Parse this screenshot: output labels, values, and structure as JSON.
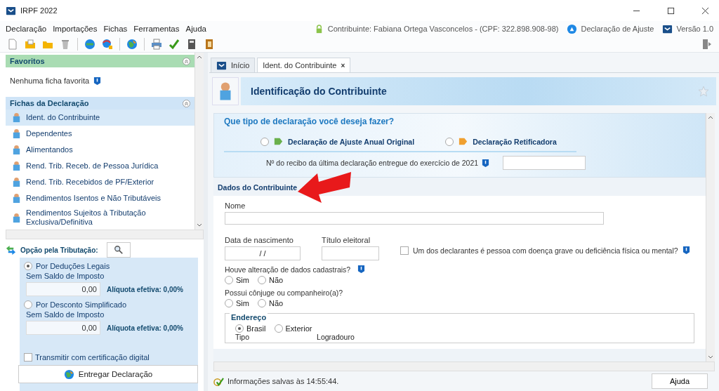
{
  "window": {
    "title": "IRPF 2022"
  },
  "menu": [
    {
      "label": "Declaração"
    },
    {
      "label": "Importações"
    },
    {
      "label": "Fichas"
    },
    {
      "label": "Ferramentas"
    },
    {
      "label": "Ajuda"
    }
  ],
  "header_info": {
    "contributor": "Contribuinte: Fabiana Ortega Vasconcelos - (CPF: 322.898.908-98)",
    "declaration": "Declaração de Ajuste",
    "version": "Versão 1.0"
  },
  "sidebar": {
    "favorites": {
      "title": "Favoritos",
      "empty_text": "Nenhuma ficha favorita"
    },
    "forms": {
      "title": "Fichas da Declaração",
      "items": [
        {
          "label": "Ident. do Contribuinte",
          "selected": true
        },
        {
          "label": "Dependentes",
          "selected": false
        },
        {
          "label": "Alimentandos",
          "selected": false
        },
        {
          "label": "Rend. Trib. Receb. de Pessoa Jurídica",
          "selected": false
        },
        {
          "label": "Rend. Trib. Recebidos de PF/Exterior",
          "selected": false
        },
        {
          "label": "Rendimentos Isentos e Não Tributáveis",
          "selected": false
        },
        {
          "label": "Rendimentos Sujeitos à Tributação Exclusiva/Definitiva",
          "selected": false
        }
      ]
    },
    "tax_option": {
      "title": "Opção pela Tributação:",
      "options": [
        {
          "label": "Por Deduções Legais",
          "selected": true,
          "balance_label": "Sem Saldo de Imposto",
          "value": "0,00",
          "rate": "Alíquota efetiva: 0,00%"
        },
        {
          "label": "Por Desconto Simplificado",
          "selected": false,
          "balance_label": "Sem Saldo de Imposto",
          "value": "0,00",
          "rate": "Alíquota efetiva: 0,00%"
        }
      ]
    },
    "certificate": {
      "label": "Transmitir com certificação digital",
      "checked": false
    },
    "submit_button": "Entregar Declaração"
  },
  "tabs": [
    {
      "label": "Início",
      "selected": false
    },
    {
      "label": "Ident. do Contribuinte",
      "selected": true,
      "close": "×"
    }
  ],
  "page_title": "Identificação do Contribuinte",
  "declaration_type": {
    "question": "Que tipo de declaração você deseja fazer?",
    "options": [
      {
        "label": "Declaração de Ajuste Anual Original",
        "selected": false
      },
      {
        "label": "Declaração Retificadora",
        "selected": false
      }
    ],
    "receipt_label": "Nº do recibo da última declaração entregue do exercício de 2021"
  },
  "section_title": "Dados do Contribuinte",
  "name_label": "Nome",
  "birth_label": "Data de nascimento",
  "birth_value": " / /",
  "voter_label": "Título eleitoral",
  "disability": {
    "label": "Um dos declarantes é pessoa com doença grave ou deficiência física ou mental?",
    "checked": false
  },
  "questions": [
    {
      "label": "Houve alteração de dados cadastrais?",
      "info": true,
      "options": [
        {
          "label": "Sim",
          "selected": false
        },
        {
          "label": "Não",
          "selected": false
        }
      ]
    },
    {
      "label": "Possui cônjuge ou companheiro(a)?",
      "info": false,
      "options": [
        {
          "label": "Sim",
          "selected": false
        },
        {
          "label": "Não",
          "selected": false
        }
      ]
    }
  ],
  "address": {
    "legend": "Endereço",
    "options": [
      {
        "label": "Brasil",
        "selected": true
      },
      {
        "label": "Exterior",
        "selected": false
      }
    ],
    "columns": [
      "Tipo",
      "Logradouro"
    ]
  },
  "status_bar": {
    "message": "Informações salvas às 14:55:44.",
    "help_button": "Ajuda"
  }
}
